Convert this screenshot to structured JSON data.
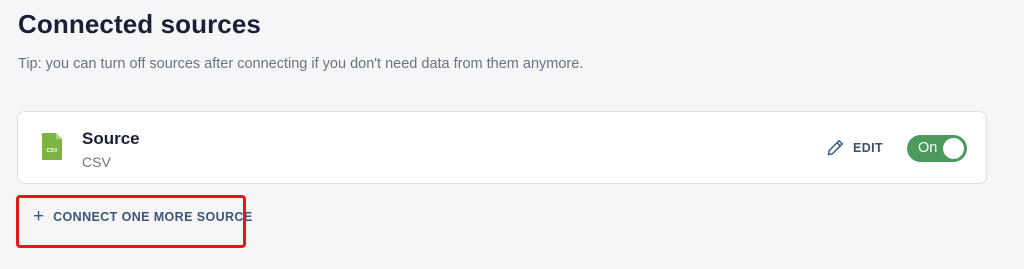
{
  "page": {
    "title": "Connected sources",
    "tip": "Tip: you can turn off sources after connecting if you don't need data from them anymore."
  },
  "sources": [
    {
      "name": "Source",
      "type": "CSV",
      "icon": "csv-file-icon",
      "icon_label": "CSV",
      "edit_label": "EDIT",
      "toggle_label": "On",
      "toggle_on": true
    }
  ],
  "actions": {
    "connect_label": "CONNECT ONE MORE SOURCE",
    "connect_icon": "plus-icon"
  },
  "colors": {
    "toggle_on": "#4c9a5e",
    "action_text": "#3d5577",
    "highlight": "#e01818",
    "csv_icon": "#7cb342"
  }
}
